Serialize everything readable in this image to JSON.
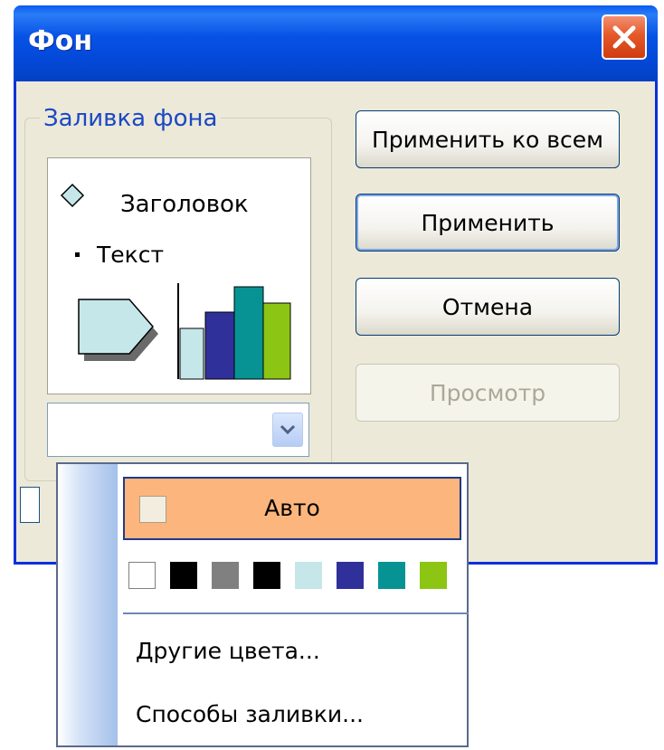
{
  "dialog": {
    "title": "Фон",
    "close_icon": "close-icon",
    "group_label": "Заливка фона",
    "preview": {
      "heading": "Заголовок",
      "text": "Текст",
      "chart_colors": [
        "#c5e7ea",
        "#30309a",
        "#079393",
        "#8cc514"
      ]
    },
    "buttons": {
      "apply_all": "Применить ко всем",
      "apply": "Применить",
      "cancel": "Отмена",
      "preview": "Просмотр"
    }
  },
  "popup": {
    "auto_label": "Авто",
    "swatches": [
      "#ffffff",
      "#000000",
      "#808080",
      "#000000",
      "#c5e7ea",
      "#30309a",
      "#079393",
      "#8cc514"
    ],
    "more_colors": "Другие цвета...",
    "fill_effects": "Способы заливки..."
  },
  "colors": {
    "titlebar": "#0753e6",
    "auto_highlight": "#fcb57c",
    "dialog_bg": "#ece9d8"
  }
}
